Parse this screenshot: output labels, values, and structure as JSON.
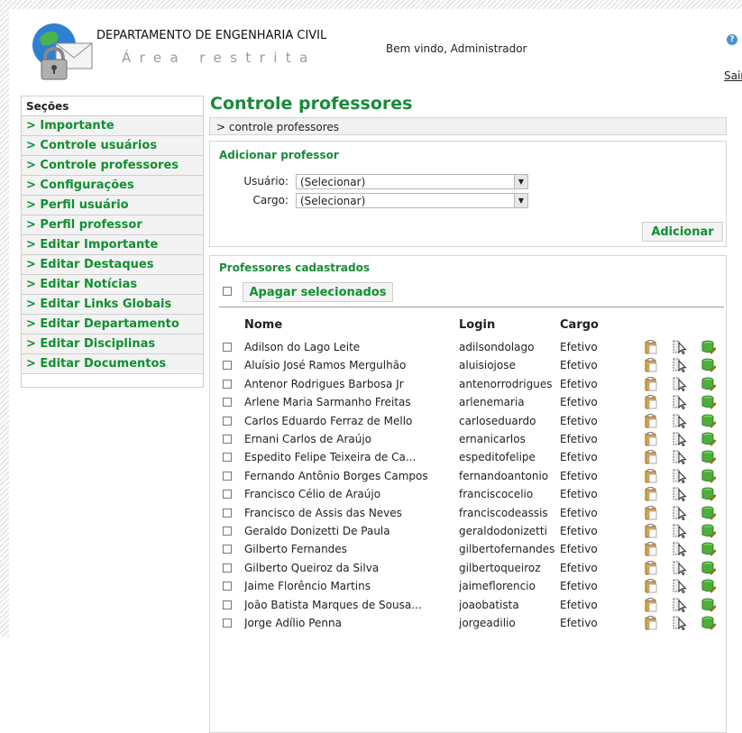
{
  "header": {
    "department": "DEPARTAMENTO DE ENGENHARIA CIVIL",
    "area": "Área restrita",
    "welcome": "Bem vindo, Administrador",
    "logout": "Sair"
  },
  "sidebar": {
    "title": "Seções",
    "items": [
      "> Importante",
      "> Controle usuários",
      "> Controle professores",
      "> Configurações",
      "> Perfil usuário",
      "> Perfil professor",
      "> Editar Importante",
      "> Editar Destaques",
      "> Editar Notícias",
      "> Editar Links Globais",
      "> Editar Departamento",
      "> Editar Disciplinas",
      "> Editar Documentos"
    ]
  },
  "main": {
    "title": "Controle professores",
    "breadcrumb": "> controle professores",
    "add_panel": {
      "title": "Adicionar professor",
      "usuario_label": "Usuário:",
      "usuario_value": "(Selecionar)",
      "cargo_label": "Cargo:",
      "cargo_value": "(Selecionar)",
      "add_button": "Adicionar"
    },
    "list_panel": {
      "title": "Professores cadastrados",
      "delete_button": "Apagar selecionados",
      "columns": [
        "Nome",
        "Login",
        "Cargo"
      ],
      "rows": [
        {
          "name": "Adilson do Lago Leite",
          "login": "adilsondolago",
          "cargo": "Efetivo"
        },
        {
          "name": "Aluísio José Ramos Mergulhão",
          "login": "aluisiojose",
          "cargo": "Efetivo"
        },
        {
          "name": "Antenor Rodrigues Barbosa Jr",
          "login": "antenorrodrigues",
          "cargo": "Efetivo"
        },
        {
          "name": "Arlene Maria Sarmanho Freitas",
          "login": "arlenemaria",
          "cargo": "Efetivo"
        },
        {
          "name": "Carlos Eduardo Ferraz de Mello",
          "login": "carloseduardo",
          "cargo": "Efetivo"
        },
        {
          "name": "Ernani Carlos de Araújo",
          "login": "ernanicarlos",
          "cargo": "Efetivo"
        },
        {
          "name": "Espedito Felipe Teixeira de Ca...",
          "login": "espeditofelipe",
          "cargo": "Efetivo"
        },
        {
          "name": "Fernando Antônio Borges Campos",
          "login": "fernandoantonio",
          "cargo": "Efetivo"
        },
        {
          "name": "Francisco Célio de Araújo",
          "login": "franciscocelio",
          "cargo": "Efetivo"
        },
        {
          "name": "Francisco de Assis das Neves",
          "login": "franciscodeassis",
          "cargo": "Efetivo"
        },
        {
          "name": "Geraldo Donizetti De Paula",
          "login": "geraldodonizetti",
          "cargo": "Efetivo"
        },
        {
          "name": "Gilberto Fernandes",
          "login": "gilbertofernandes",
          "cargo": "Efetivo"
        },
        {
          "name": "Gilberto Queiroz da Silva",
          "login": "gilbertoqueiroz",
          "cargo": "Efetivo"
        },
        {
          "name": "Jaime Florêncio Martins",
          "login": "jaimeflorencio",
          "cargo": "Efetivo"
        },
        {
          "name": "João Batista Marques de Sousa...",
          "login": "joaobatista",
          "cargo": "Efetivo"
        },
        {
          "name": "Jorge Adílio Penna",
          "login": "jorgeadilio",
          "cargo": "Efetivo"
        }
      ]
    }
  },
  "colors": {
    "accent_green": "#109030",
    "title_green": "#1a8a3a",
    "panel_bg": "#f3f3f3"
  },
  "row_icons": [
    "clipboard-icon",
    "select-cursor-icon",
    "db-edit-icon"
  ]
}
